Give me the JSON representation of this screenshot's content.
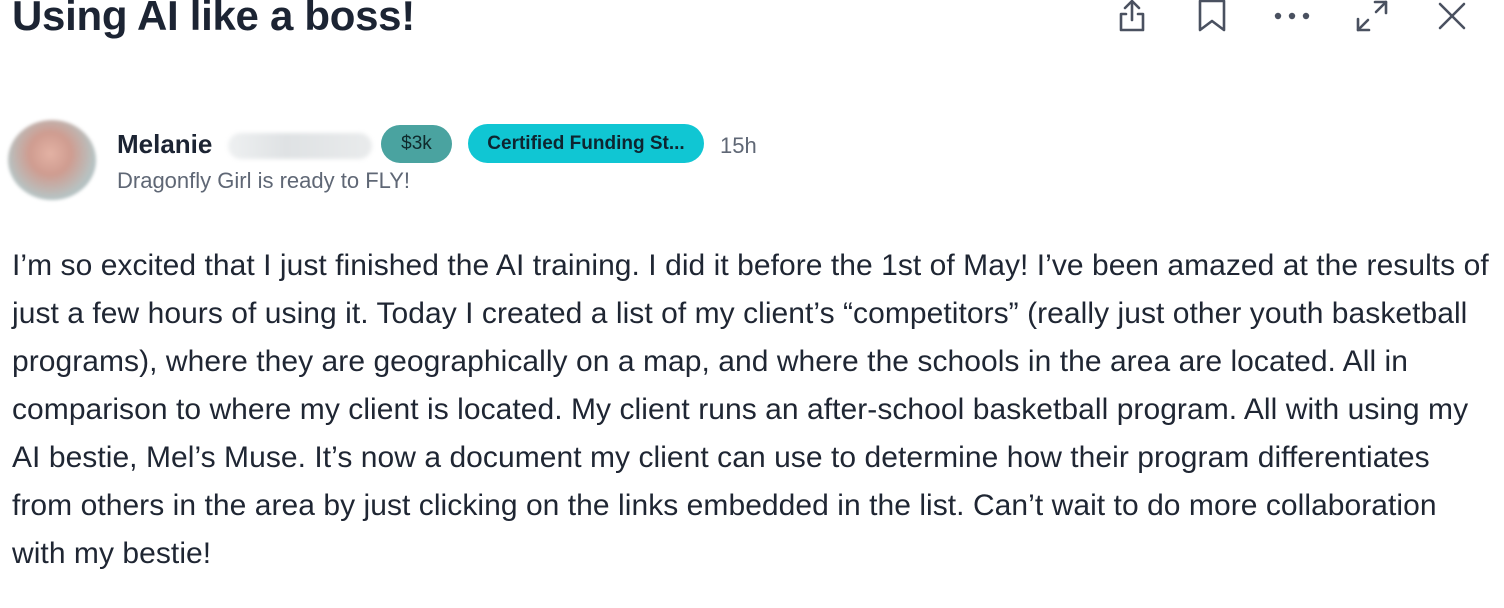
{
  "post": {
    "title": "Using AI like a boss!",
    "body": "I’m so excited that I just finished the AI training. I did it before the 1st of May! I’ve been amazed at the results of just a few hours of using it. Today I created a list of my client’s “competitors” (really just other youth basketball programs), where they are geographically on a map, and where the schools in the area are located. All in comparison to where my client is located. My client runs an after-school basketball program. All with using my AI bestie, Mel’s Muse. It’s now a document my client can use to determine how their program differentiates from others in the area by just clicking on the links embedded in the list. Can’t wait to do more collaboration with my bestie!"
  },
  "author": {
    "name": "Melanie",
    "level_badge": "$3k",
    "role_badge": "Certified Funding St...",
    "time": "15h",
    "tagline": "Dragonfly Girl is ready to FLY!"
  },
  "toolbar": {
    "icons": [
      "share-icon",
      "bookmark-icon",
      "more-icon",
      "expand-icon",
      "close-icon"
    ]
  },
  "colors": {
    "title": "#1c2433",
    "level_badge_bg": "#4aa3a0",
    "role_badge_bg": "#10c6d3",
    "muted_text": "#5f6775",
    "icon_stroke": "#4a5160"
  }
}
